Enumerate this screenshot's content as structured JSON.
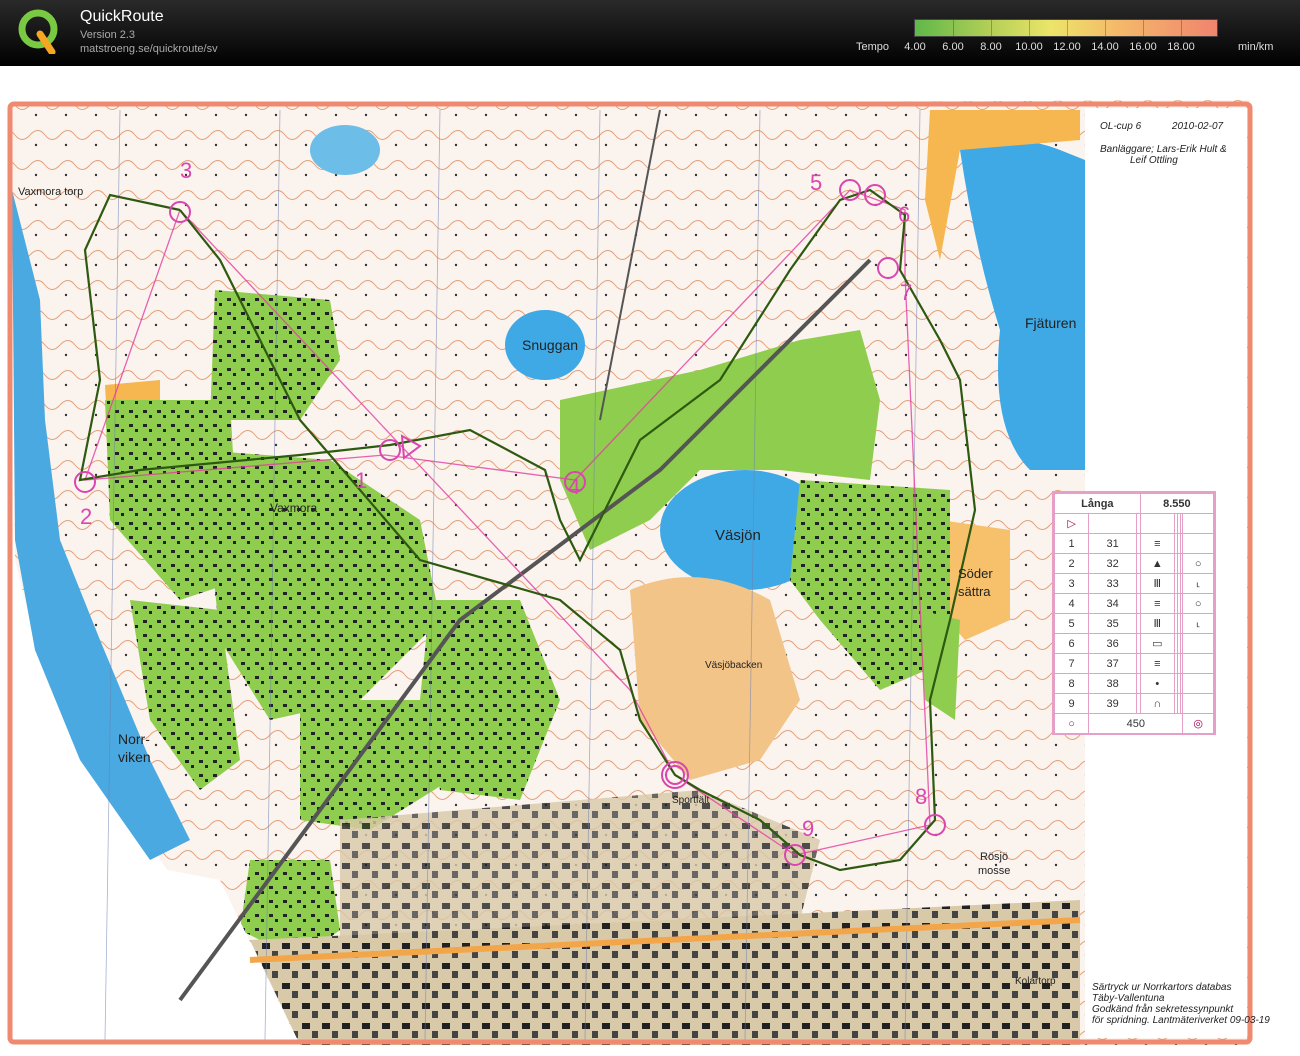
{
  "app": {
    "title": "QuickRoute",
    "version": "Version 2.3",
    "url": "matstroeng.se/quickroute/sv"
  },
  "tempo_scale": {
    "label": "Tempo",
    "ticks": [
      "4.00",
      "6.00",
      "8.00",
      "10.00",
      "12.00",
      "14.00",
      "16.00",
      "18.00"
    ],
    "unit": "min/km",
    "colors": {
      "low": "#5fb84a",
      "mid": "#ece569",
      "high": "#f0846e"
    }
  },
  "map": {
    "place_names": {
      "vaxmora_torp": "Vaxmora torp",
      "snuggan": "Snuggan",
      "fjaturen": "Fjäturen",
      "vaxmora": "Vaxmora",
      "vasjon": "Väsjön",
      "soder_1": "Söder",
      "soder_2": "sättra",
      "vasjobacken": "Väsjöbacken",
      "norrviken_1": "Norr-",
      "norrviken_2": "viken",
      "sportfalt": "Sportfält",
      "rosjo_1": "Rösjö",
      "rosjo_2": "mosse",
      "kolartorp": "Kolartorp"
    },
    "control_numbers": [
      "1",
      "2",
      "3",
      "4",
      "5",
      "6",
      "7",
      "8",
      "9"
    ],
    "header": {
      "event": "OL-cup 6",
      "date": "2010-02-07",
      "setter_1": "Banläggare; Lars-Erik Hult &",
      "setter_2": "Leif Ottling"
    },
    "footer": {
      "line1": "Särtryck ur Norrkartors databas",
      "line2": "Täby-Vallentuna",
      "line3": "Godkänd från sekretessynpunkt",
      "line4": "för spridning. Lantmäteriverket 09-03-19"
    },
    "control_description": {
      "course": "Långa",
      "length": "8.550",
      "rows": [
        {
          "num": "1",
          "code": "31"
        },
        {
          "num": "2",
          "code": "32"
        },
        {
          "num": "3",
          "code": "33"
        },
        {
          "num": "4",
          "code": "34"
        },
        {
          "num": "5",
          "code": "35"
        },
        {
          "num": "6",
          "code": "36"
        },
        {
          "num": "7",
          "code": "37"
        },
        {
          "num": "8",
          "code": "38"
        },
        {
          "num": "9",
          "code": "39"
        }
      ],
      "finish": "450"
    }
  }
}
